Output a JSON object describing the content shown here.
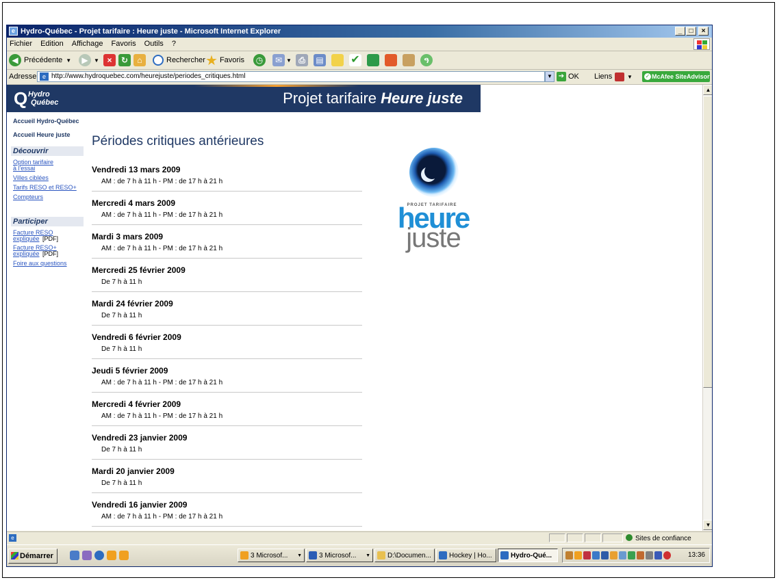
{
  "window": {
    "title": "Hydro-Québec - Projet tarifaire : Heure juste - Microsoft Internet Explorer",
    "controls": {
      "minimize": "_",
      "maximize": "□",
      "close": "×"
    }
  },
  "menu": [
    "Fichier",
    "Edition",
    "Affichage",
    "Favoris",
    "Outils",
    "?"
  ],
  "toolbar": {
    "back": "Précédente",
    "search": "Rechercher",
    "favorites": "Favoris"
  },
  "address": {
    "label": "Adresse",
    "url": "http://www.hydroquebec.com/heurejuste/periodes_critiques.html",
    "go": "OK",
    "links": "Liens",
    "mcafee": "McAfee SiteAdvisor"
  },
  "banner": {
    "logo_line1": "Hydro",
    "logo_line2": "Québec",
    "title_prefix": "Projet tarifaire",
    "title_emph": "Heure juste"
  },
  "nav": {
    "top_links": [
      "Accueil Hydro-Québec",
      "Accueil Heure juste"
    ],
    "decouvrir": {
      "heading": "Découvrir",
      "links": [
        "Option tarifaire",
        "à l'essai",
        "Villes ciblées",
        "Tarifs RESO et RESO+",
        "Compteurs"
      ]
    },
    "participer": {
      "heading": "Participer",
      "links": [
        "Facture RESO",
        "expliquée",
        "Facture RESO+",
        "expliquée",
        "Foire aux questions"
      ],
      "pdf": "[PDF]"
    }
  },
  "main": {
    "title": "Périodes critiques antérieures",
    "entries": [
      {
        "date": "Vendredi 13 mars 2009",
        "time": "AM : de 7 h à 11 h  -  PM : de 17 h à 21 h"
      },
      {
        "date": "Mercredi 4 mars 2009",
        "time": "AM : de 7 h à 11 h  -  PM : de 17 h à 21 h"
      },
      {
        "date": "Mardi 3 mars 2009",
        "time": "AM : de 7 h à 11 h  -  PM : de 17 h à 21 h"
      },
      {
        "date": "Mercredi 25 février 2009",
        "time": "De 7 h à 11 h"
      },
      {
        "date": "Mardi 24 février 2009",
        "time": "De 7 h à 11 h"
      },
      {
        "date": "Vendredi 6 février 2009",
        "time": "De 7 h à 11 h"
      },
      {
        "date": "Jeudi 5 février 2009",
        "time": "AM : de 7 h à 11 h  -  PM : de 17 h à 21 h"
      },
      {
        "date": "Mercredi 4 février 2009",
        "time": "AM : de 7 h à 11 h  -  PM : de 17 h à 21 h"
      },
      {
        "date": "Vendredi 23 janvier 2009",
        "time": "De 7 h à 11 h"
      },
      {
        "date": "Mardi 20 janvier 2009",
        "time": "De 7 h à 11 h"
      },
      {
        "date": "Vendredi 16 janvier 2009",
        "time": "AM : de 7 h à 11 h  -  PM : de 17 h à 21 h"
      }
    ]
  },
  "side_logo": {
    "tagline": "PROJET TARIFAIRE",
    "word1": "heure",
    "word2": "juste"
  },
  "status": {
    "zone": "Sites de confiance"
  },
  "taskbar": {
    "start": "Démarrer",
    "tasks": [
      "3 Microsof...",
      "3 Microsof...",
      "D:\\Documen...",
      "Hockey | Ho...",
      "Hydro-Qué..."
    ],
    "clock": "13:36"
  },
  "colors": {
    "brand_navy": "#1F3864",
    "link_blue": "#2A55C0",
    "heure_blue": "#1F8FD6",
    "titlebar": "#0A246A"
  }
}
